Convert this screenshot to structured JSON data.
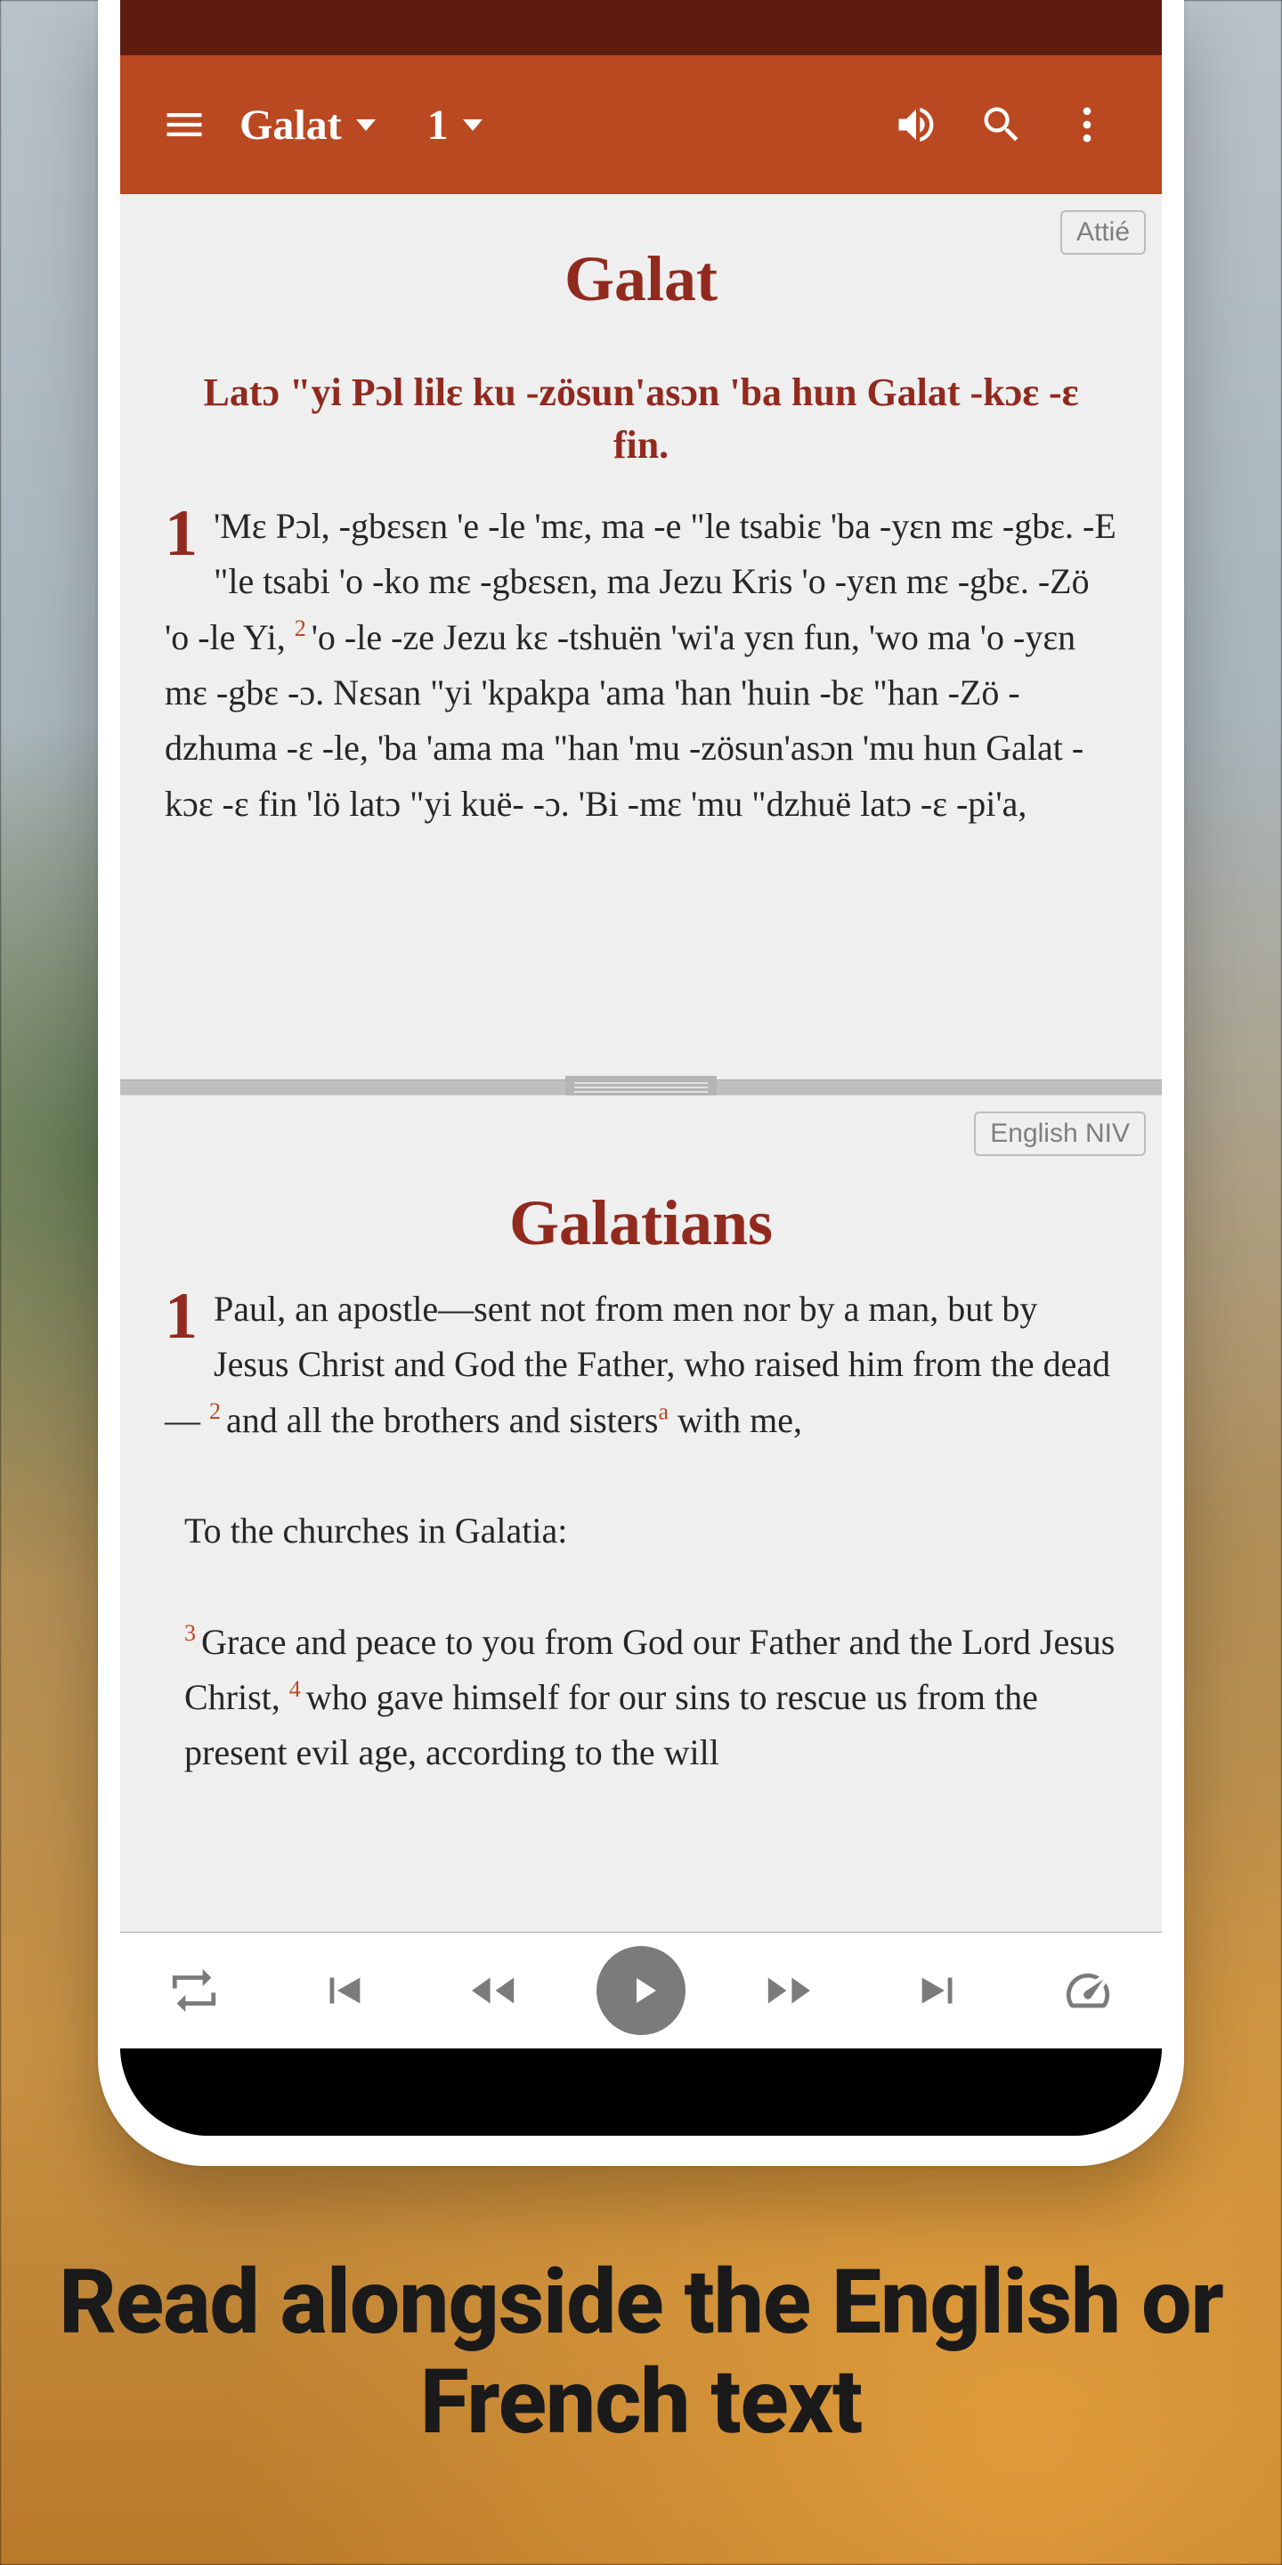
{
  "toolbar": {
    "book_label": "Galat",
    "chapter_label": "1"
  },
  "top_pane": {
    "language_tag": "Attié",
    "book_title": "Galat",
    "section_heading": "Latɔ \"yi Pɔl lilɛ ku -zösun'asɔn 'ba hun Galat -kɔɛ -ɛ fin.",
    "chapter_number": "1",
    "verses": [
      {
        "n": "",
        "text": "'Mɛ Pɔl, -gbɛsɛn 'e -le 'mɛ, ma -e \"le tsabiɛ 'ba -yɛn mɛ -gbɛ. -E \"le tsabi 'o -ko mɛ -gbɛsɛn, ma Jezu Kris 'o -yɛn mɛ -gbɛ. -Zö 'o -le Yi, "
      },
      {
        "n": "2",
        "text": "'o -le -ze Jezu kɛ -tshuën 'wi'a yɛn fun, 'wo ma 'o -yɛn mɛ -gbɛ -ɔ. Nɛsan \"yi 'kpakpa 'ama 'han 'huin -bɛ \"han -Zö -dzhuma -ɛ -le, 'ba 'ama ma \"han 'mu -zösun'asɔn 'mu hun Galat -kɔɛ -ɛ fin 'lö latɔ \"yi kuë- -ɔ. 'Bi -mɛ 'mu \"dzhuë latɔ -ɛ -pi'a,"
      }
    ]
  },
  "bottom_pane": {
    "language_tag": "English NIV",
    "book_title": "Galatians",
    "chapter_number": "1",
    "verses": [
      {
        "n": "",
        "text": "Paul, an apostle—sent not from men nor by a man, but by Jesus Christ and God the Father, who raised him from the dead— "
      },
      {
        "n": "2",
        "text": "and all the brothers and sisters",
        "footnote": "a",
        "tail": " with me,"
      }
    ],
    "address_line": "To the churches in Galatia:",
    "verses2": [
      {
        "n": "3",
        "text": "Grace and peace to you from God our Father and the Lord Jesus Christ, "
      },
      {
        "n": "4",
        "text": "who gave himself for our sins to rescue us from the present evil age, according to the will"
      }
    ]
  },
  "caption": "Read alongside the English or French text"
}
